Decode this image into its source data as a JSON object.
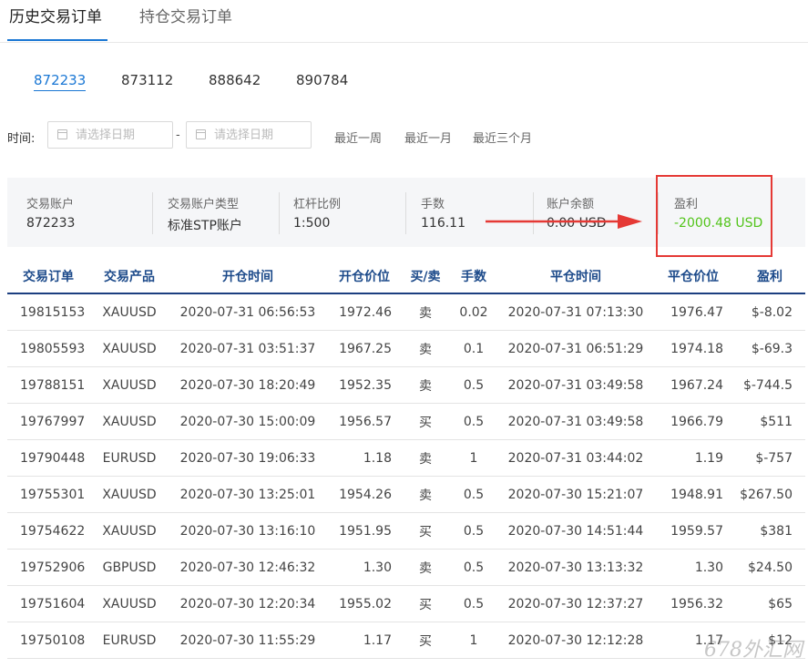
{
  "tabs": [
    {
      "label": "历史交易订单",
      "active": true
    },
    {
      "label": "持仓交易订单",
      "active": false
    }
  ],
  "accounts": [
    {
      "number": "872233",
      "active": true
    },
    {
      "number": "873112",
      "active": false
    },
    {
      "number": "888642",
      "active": false
    },
    {
      "number": "890784",
      "active": false
    }
  ],
  "filter": {
    "label": "时间:",
    "start_placeholder": "请选择日期",
    "end_placeholder": "请选择日期",
    "separator": "-",
    "quick": [
      "最近一周",
      "最近一月",
      "最近三个月"
    ]
  },
  "summary": {
    "account_label": "交易账户",
    "account_value": "872233",
    "type_label": "交易账户类型",
    "type_value": "标准STP账户",
    "leverage_label": "杠杆比例",
    "leverage_value": "1:500",
    "lots_label": "手数",
    "lots_value": "116.11",
    "balance_label": "账户余额",
    "balance_value": "0.00 USD",
    "profit_label": "盈利",
    "profit_value": "-2000.48 USD"
  },
  "table": {
    "headers": [
      "交易订单",
      "交易产品",
      "开仓时间",
      "开仓价位",
      "买/卖",
      "手数",
      "平仓时间",
      "平仓价位",
      "盈利"
    ],
    "rows": [
      [
        "19815153",
        "XAUUSD",
        "2020-07-31 06:56:53",
        "1972.46",
        "卖",
        "0.02",
        "2020-07-31 07:13:30",
        "1976.47",
        "$-8.02"
      ],
      [
        "19805593",
        "XAUUSD",
        "2020-07-31 03:51:37",
        "1967.25",
        "卖",
        "0.1",
        "2020-07-31 06:51:29",
        "1974.18",
        "$-69.3"
      ],
      [
        "19788151",
        "XAUUSD",
        "2020-07-30 18:20:49",
        "1952.35",
        "卖",
        "0.5",
        "2020-07-31 03:49:58",
        "1967.24",
        "$-744.5"
      ],
      [
        "19767997",
        "XAUUSD",
        "2020-07-30 15:00:09",
        "1956.57",
        "买",
        "0.5",
        "2020-07-31 03:49:58",
        "1966.79",
        "$511"
      ],
      [
        "19790448",
        "EURUSD",
        "2020-07-30 19:06:33",
        "1.18",
        "卖",
        "1",
        "2020-07-31 03:44:02",
        "1.19",
        "$-757"
      ],
      [
        "19755301",
        "XAUUSD",
        "2020-07-30 13:25:01",
        "1954.26",
        "卖",
        "0.5",
        "2020-07-30 15:21:07",
        "1948.91",
        "$267.50"
      ],
      [
        "19754622",
        "XAUUSD",
        "2020-07-30 13:16:10",
        "1951.95",
        "买",
        "0.5",
        "2020-07-30 14:51:44",
        "1959.57",
        "$381"
      ],
      [
        "19752906",
        "GBPUSD",
        "2020-07-30 12:46:32",
        "1.30",
        "卖",
        "0.5",
        "2020-07-30 13:13:32",
        "1.30",
        "$24.50"
      ],
      [
        "19751604",
        "XAUUSD",
        "2020-07-30 12:20:34",
        "1955.02",
        "买",
        "0.5",
        "2020-07-30 12:37:27",
        "1956.32",
        "$65"
      ],
      [
        "19750108",
        "EURUSD",
        "2020-07-30 11:55:29",
        "1.17",
        "买",
        "1",
        "2020-07-30 12:12:28",
        "1.17",
        "$12"
      ]
    ]
  },
  "colors": {
    "accent": "#1a77d4",
    "profit_positive": "#52c41a",
    "header_text": "#1c4a8a",
    "highlight_box": "#e53935"
  },
  "watermark": "678外汇网"
}
